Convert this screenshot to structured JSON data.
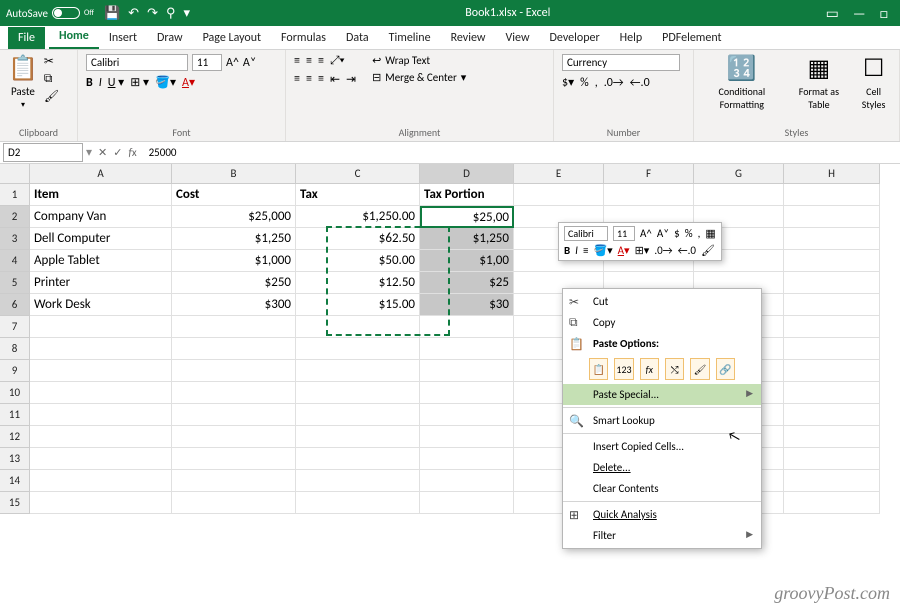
{
  "title_bar": {
    "autosave_label": "AutoSave",
    "autosave_state": "Off",
    "document_title": "Book1.xlsx - Excel"
  },
  "ribbon_tabs": [
    "File",
    "Home",
    "Insert",
    "Draw",
    "Page Layout",
    "Formulas",
    "Data",
    "Timeline",
    "Review",
    "View",
    "Developer",
    "Help",
    "PDFelement"
  ],
  "active_tab": "Home",
  "ribbon": {
    "clipboard": {
      "label": "Clipboard",
      "paste_label": "Paste"
    },
    "font": {
      "label": "Font",
      "font_name": "Calibri",
      "font_size": "11"
    },
    "alignment": {
      "label": "Alignment",
      "wrap_text": "Wrap Text",
      "merge_center": "Merge & Center"
    },
    "number": {
      "label": "Number",
      "format": "Currency"
    },
    "styles": {
      "label": "Styles",
      "conditional": "Conditional Formatting",
      "format_table": "Format as Table",
      "cell_styles": "Cell Styles"
    }
  },
  "formula_bar": {
    "name_box": "D2",
    "formula": "25000"
  },
  "columns": [
    "A",
    "B",
    "C",
    "D",
    "E",
    "F",
    "G",
    "H"
  ],
  "header_row": {
    "a": "Item",
    "b": "Cost",
    "c": "Tax",
    "d": "Tax Portion"
  },
  "rows": [
    {
      "a": "Company Van",
      "b": "$25,000",
      "c": "$1,250.00",
      "d": "$25,00"
    },
    {
      "a": "Dell Computer",
      "b": "$1,250",
      "c": "$62.50",
      "d": "$1,250"
    },
    {
      "a": "Apple Tablet",
      "b": "$1,000",
      "c": "$50.00",
      "d": "$1,00"
    },
    {
      "a": "Printer",
      "b": "$250",
      "c": "$12.50",
      "d": "$25"
    },
    {
      "a": "Work Desk",
      "b": "$300",
      "c": "$15.00",
      "d": "$30"
    }
  ],
  "mini_toolbar": {
    "font_name": "Calibri",
    "font_size": "11"
  },
  "context_menu": {
    "cut": "Cut",
    "copy": "Copy",
    "paste_options": "Paste Options:",
    "paste_special": "Paste Special...",
    "smart_lookup": "Smart Lookup",
    "insert_copied": "Insert Copied Cells...",
    "delete": "Delete...",
    "clear_contents": "Clear Contents",
    "quick_analysis": "Quick Analysis",
    "filter": "Filter"
  },
  "watermark": "groovyPost.com"
}
